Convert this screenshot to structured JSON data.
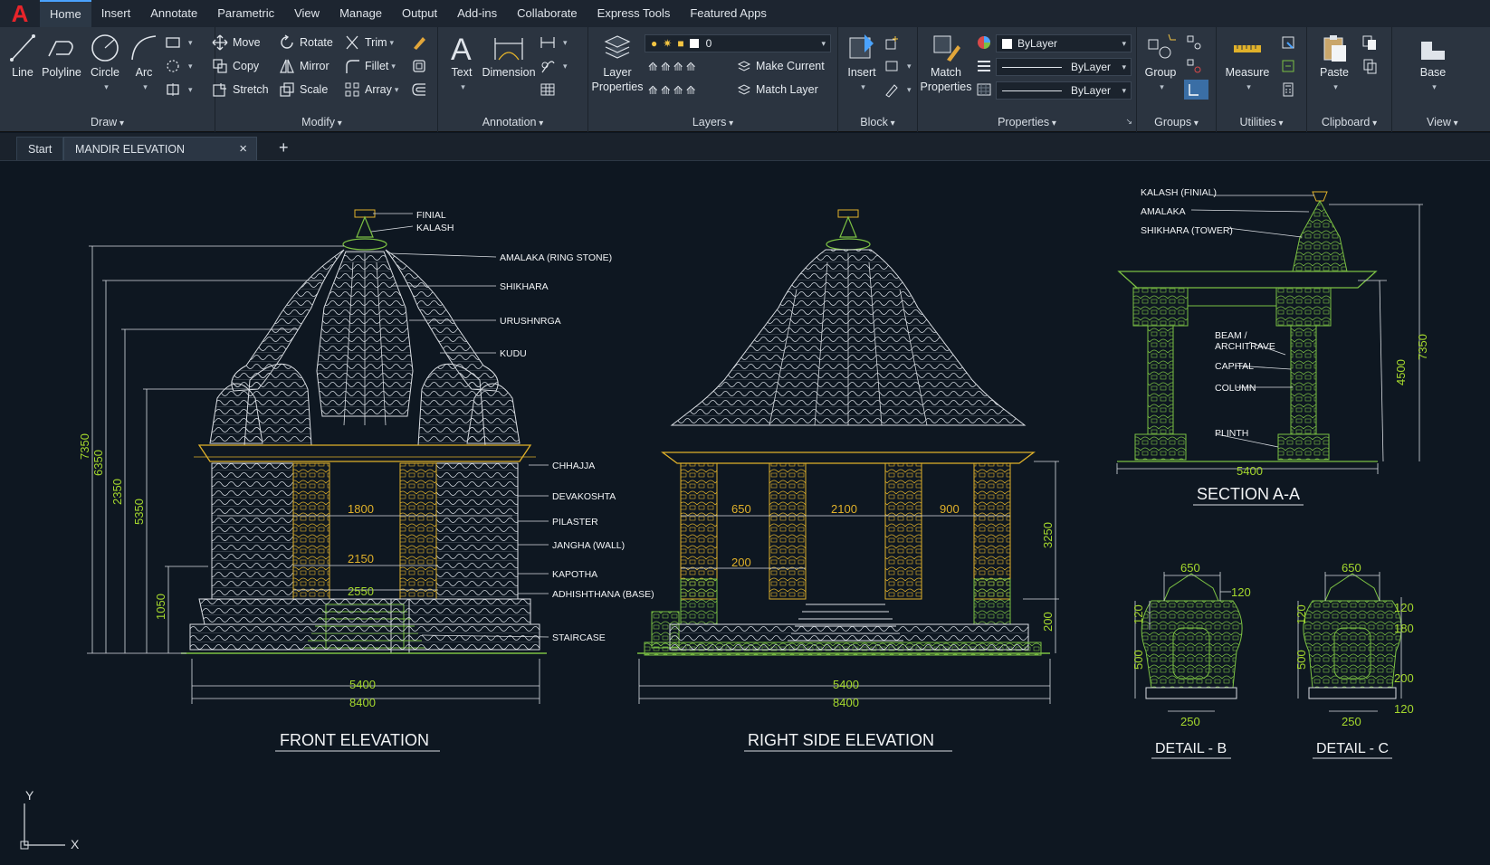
{
  "app": {
    "logo_letter": "A",
    "accent": "#e8242a"
  },
  "menu": {
    "tabs": [
      "Home",
      "Insert",
      "Annotate",
      "Parametric",
      "View",
      "Manage",
      "Output",
      "Add-ins",
      "Collaborate",
      "Express Tools",
      "Featured Apps"
    ],
    "active": "Home"
  },
  "ribbon": {
    "draw": {
      "title": "Draw",
      "line": "Line",
      "polyline": "Polyline",
      "circle": "Circle",
      "arc": "Arc"
    },
    "modify": {
      "title": "Modify",
      "move": "Move",
      "rotate": "Rotate",
      "trim": "Trim",
      "copy": "Copy",
      "mirror": "Mirror",
      "fillet": "Fillet",
      "stretch": "Stretch",
      "scale": "Scale",
      "array": "Array"
    },
    "annotation": {
      "title": "Annotation",
      "text": "Text",
      "dimension": "Dimension"
    },
    "layers": {
      "title": "Layers",
      "layer_properties_1": "Layer",
      "layer_properties_2": "Properties",
      "current_layer": "0",
      "make_current": "Make Current",
      "match_layer": "Match Layer"
    },
    "block": {
      "title": "Block",
      "insert": "Insert"
    },
    "properties": {
      "title": "Properties",
      "match_1": "Match",
      "match_2": "Properties",
      "color": "ByLayer",
      "linetype": "ByLayer",
      "lineweight": "ByLayer"
    },
    "groups": {
      "title": "Groups",
      "group": "Group"
    },
    "utilities": {
      "title": "Utilities",
      "measure": "Measure"
    },
    "clipboard": {
      "title": "Clipboard",
      "paste": "Paste"
    },
    "view": {
      "title": "View",
      "base": "Base"
    }
  },
  "tabs": {
    "start": "Start",
    "document": "MANDIR ELEVATION DRAWING*",
    "close": "×",
    "new": "+"
  },
  "drawing": {
    "front": {
      "title": "FRONT ELEVATION",
      "labels": [
        "FINIAL",
        "KALASH",
        "AMALAKA (RING STONE)",
        "SHIKHARA",
        "URUSHNRGA",
        "KUDU",
        "CHHAJJA",
        "DEVAKOSHTA",
        "PILASTER",
        "JANGHA (WALL)",
        "KAPOTHA",
        "ADHISHTHANA (BASE)",
        "STAIRCASE"
      ],
      "dims": {
        "d7350": "7350",
        "d6350": "6350",
        "d2350": "2350",
        "d5350": "5350",
        "d1050": "1050",
        "d1800": "1800",
        "d2150": "2150",
        "d2550": "2550",
        "d5400": "5400",
        "d8400": "8400"
      }
    },
    "side": {
      "title": "RIGHT SIDE ELEVATION",
      "dims": {
        "d650": "650",
        "d2100": "2100",
        "d900": "900",
        "d200a": "200",
        "d3250": "3250",
        "d200b": "200",
        "d5400": "5400",
        "d8400": "8400"
      }
    },
    "section": {
      "title": "SECTION A-A",
      "labels": [
        "KALASH (FINIAL)",
        "AMALAKA",
        "SHIKHARA (TOWER)",
        "BEAM /",
        "ARCHITRAVE",
        "CAPITAL",
        "COLUMN",
        "PLINTH"
      ],
      "dims": {
        "d7350": "7350",
        "d4500": "4500",
        "d5400": "5400"
      }
    },
    "detail_b": {
      "title": "DETAIL - B",
      "dims": {
        "top": "650",
        "r120": "120",
        "l120": "120",
        "l500": "500",
        "bottom": "250"
      }
    },
    "detail_c": {
      "title": "DETAIL - C",
      "dims": {
        "top": "650",
        "l120": "120",
        "l500": "500",
        "r120a": "120",
        "r180": "180",
        "r200": "200",
        "r120b": "120",
        "bottom": "250"
      }
    },
    "ucs": {
      "y": "Y",
      "x": "X"
    }
  },
  "colors": {
    "white_line": "#d9dde2",
    "yellow_line": "#e0b12a",
    "green_line": "#7bc043",
    "dim_green": "#a5d82d",
    "canvas": "#0e1721"
  }
}
